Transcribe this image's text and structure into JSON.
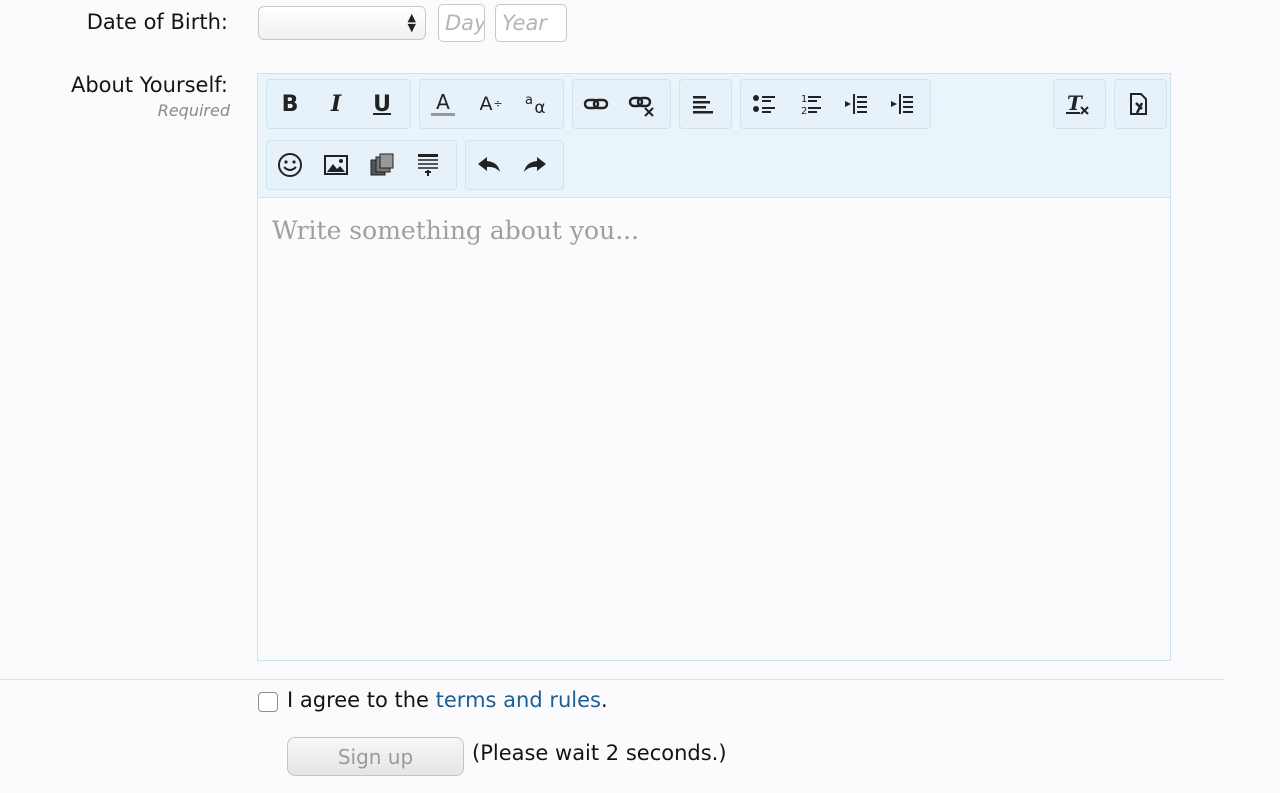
{
  "form": {
    "dob_label": "Date of Birth:",
    "day_placeholder": "Day",
    "year_placeholder": "Year",
    "about_label": "About Yourself:",
    "required_label": "Required",
    "editor_placeholder": "Write something about you...",
    "agree_prefix": "I agree to the ",
    "terms_link": "terms and rules",
    "agree_suffix": ".",
    "signup_label": "Sign up",
    "wait_text": "(Please wait 2 seconds.)"
  },
  "colors": {
    "link": "#1d5f93",
    "toolbar_bg": "#eaf4fb",
    "editor_border": "#c9e3f2"
  }
}
